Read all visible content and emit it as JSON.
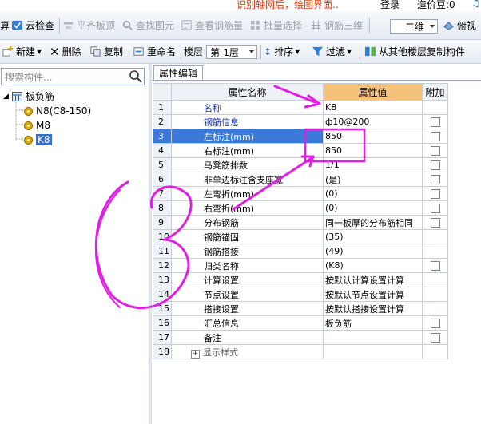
{
  "top": {
    "notice": "识别轴网后，绘图界面..",
    "login": "登录",
    "coins": "造价豆:0"
  },
  "toolbar1": {
    "suan": "算",
    "cloud_check": "云检查",
    "flush_slab_top": "平齐板顶",
    "find_element": "查找图元",
    "view_rebar_qty": "查看钢筋量",
    "batch_select": "批量选择",
    "rebar_3d": "钢筋三维",
    "view_mode": "二维",
    "top_view": "俯视"
  },
  "toolbar2": {
    "new": "新建",
    "delete": "删除",
    "copy": "复制",
    "rename": "重命名",
    "floor_label": "楼层",
    "floor_value": "第-1层",
    "sort": "排序",
    "filter": "过滤",
    "copy_from_floor": "从其他楼层复制构件"
  },
  "left": {
    "search_placeholder": "搜索构件...",
    "tree_root": "板负筋",
    "items": [
      "N8(C8-150)",
      "M8",
      "K8"
    ],
    "selected_index": 2
  },
  "panel": {
    "tab": "属性编辑",
    "headers": {
      "name": "属性名称",
      "value": "属性值",
      "extra": "附加"
    },
    "rows": [
      {
        "n": "1",
        "name": "名称",
        "value": "K8",
        "blue": true,
        "chk": false
      },
      {
        "n": "2",
        "name": "钢筋信息",
        "value": "ф10@200",
        "blue": true,
        "chk": true
      },
      {
        "n": "3",
        "name": "左标注(mm)",
        "value": "850",
        "blue": false,
        "chk": true
      },
      {
        "n": "4",
        "name": "右标注(mm)",
        "value": "850",
        "blue": false,
        "chk": true
      },
      {
        "n": "5",
        "name": "马凳筋排数",
        "value": "1/1",
        "blue": false,
        "chk": true
      },
      {
        "n": "6",
        "name": "非单边标注含支座宽",
        "value": "(是)",
        "blue": false,
        "chk": true
      },
      {
        "n": "7",
        "name": "左弯折(mm)",
        "value": "(0)",
        "blue": false,
        "chk": true
      },
      {
        "n": "8",
        "name": "右弯折(mm)",
        "value": "(0)",
        "blue": false,
        "chk": true
      },
      {
        "n": "9",
        "name": "分布钢筋",
        "value": "同一板厚的分布筋相同",
        "blue": false,
        "chk": true
      },
      {
        "n": "10",
        "name": "钢筋锚固",
        "value": "(35)",
        "blue": false,
        "chk": false
      },
      {
        "n": "11",
        "name": "钢筋搭接",
        "value": "(49)",
        "blue": false,
        "chk": false
      },
      {
        "n": "12",
        "name": "归类名称",
        "value": "(K8)",
        "blue": false,
        "chk": true
      },
      {
        "n": "13",
        "name": "计算设置",
        "value": "按默认计算设置计算",
        "blue": false,
        "chk": false
      },
      {
        "n": "14",
        "name": "节点设置",
        "value": "按默认节点设置计算",
        "blue": false,
        "chk": false
      },
      {
        "n": "15",
        "name": "搭接设置",
        "value": "按默认搭接设置计算",
        "blue": false,
        "chk": false
      },
      {
        "n": "16",
        "name": "汇总信息",
        "value": "板负筋",
        "blue": false,
        "chk": true
      },
      {
        "n": "17",
        "name": "备注",
        "value": "",
        "blue": false,
        "chk": true
      },
      {
        "n": "18",
        "name": "显示样式",
        "value": "",
        "blue": false,
        "chk": false
      }
    ],
    "highlight_row": 3
  },
  "colors": {
    "annotation": "#e020e0",
    "selection": "#3b78d8",
    "value_header": "#f4c27a"
  }
}
